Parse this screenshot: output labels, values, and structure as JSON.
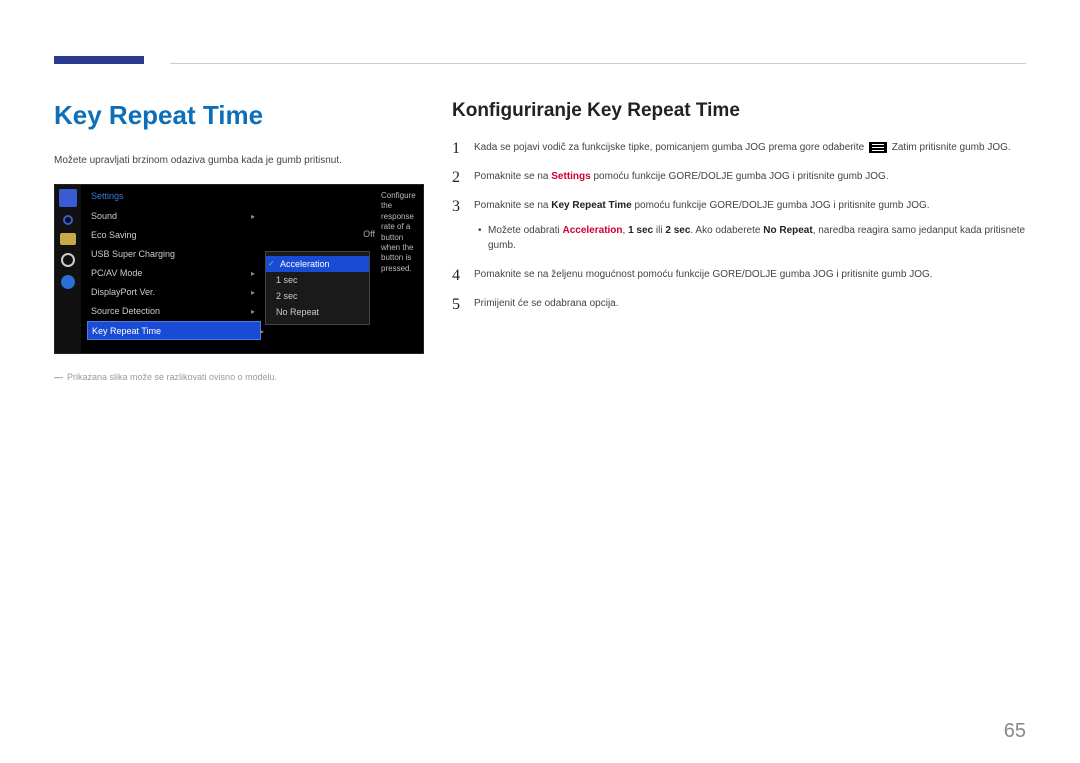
{
  "page_number": "65",
  "left": {
    "title": "Key Repeat Time",
    "intro": "Možete upravljati brzinom odaziva gumba kada je gumb pritisnut.",
    "disclaimer": "Prikazana slika može se razlikovati ovisno o modelu."
  },
  "osd": {
    "heading": "Settings",
    "items": [
      "Sound",
      "Eco Saving",
      "USB Super Charging",
      "PC/AV Mode",
      "DisplayPort Ver.",
      "Source Detection",
      "Key Repeat Time"
    ],
    "selected_index": 6,
    "eco_value": "Off",
    "popup_options": [
      "Acceleration",
      "1 sec",
      "2 sec",
      "No Repeat"
    ],
    "popup_selected_index": 0,
    "description": "Configure the response rate of a button when the button is pressed."
  },
  "right": {
    "title": "Konfiguriranje Key Repeat Time",
    "steps": {
      "s1a": "Kada se pojavi vodič za funkcijske tipke, pomicanjem gumba JOG prema gore odaberite ",
      "s1b": " Zatim pritisnite gumb JOG.",
      "s2a": "Pomaknite se na ",
      "s2_settings": "Settings",
      "s2b": " pomoću funkcije GORE/DOLJE gumba JOG i pritisnite gumb JOG.",
      "s3a": "Pomaknite se na ",
      "s3_key": "Key Repeat Time",
      "s3b": " pomoću funkcije GORE/DOLJE gumba JOG i pritisnite gumb JOG.",
      "bullet_a": "Možete odabrati ",
      "bullet_accel": "Acceleration",
      "bullet_c1": ", ",
      "bullet_1sec": "1 sec",
      "bullet_c2": " ili ",
      "bullet_2sec": "2 sec",
      "bullet_c3": ". Ako odaberete ",
      "bullet_norepeat": "No Repeat",
      "bullet_c4": ", naredba reagira samo jedanput kada pritisnete gumb.",
      "s4": "Pomaknite se na željenu mogućnost pomoću funkcije GORE/DOLJE gumba JOG i pritisnite gumb JOG.",
      "s5": "Primijenit će se odabrana opcija."
    }
  }
}
